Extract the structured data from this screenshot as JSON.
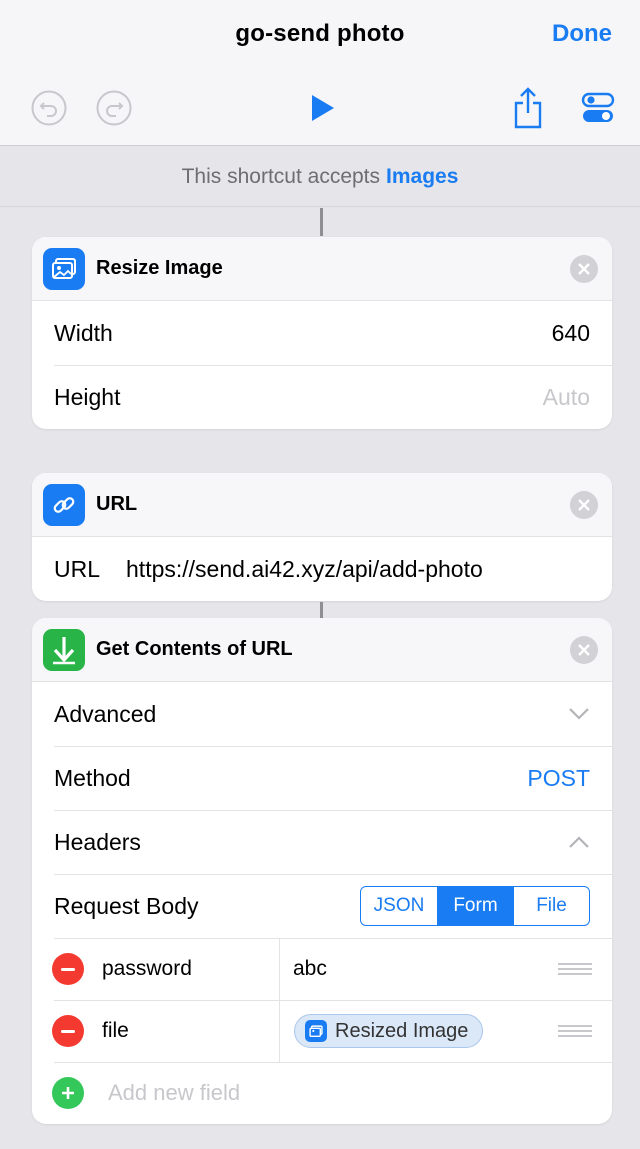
{
  "header": {
    "title": "go-send photo",
    "done_label": "Done"
  },
  "toolbar": {
    "icons": [
      "undo-icon",
      "redo-icon",
      "play-icon",
      "share-icon",
      "settings-toggle-icon"
    ]
  },
  "accepts": {
    "prefix": "This shortcut accepts",
    "type": "Images"
  },
  "actions": {
    "resize": {
      "title": "Resize Image",
      "width_label": "Width",
      "width_value": "640",
      "height_label": "Height",
      "height_placeholder": "Auto"
    },
    "url": {
      "title": "URL",
      "url_label": "URL",
      "url_value": "https://send.ai42.xyz/api/add-photo"
    },
    "get_contents": {
      "title": "Get Contents of URL",
      "advanced_label": "Advanced",
      "method_label": "Method",
      "method_value": "POST",
      "headers_label": "Headers",
      "request_body_label": "Request Body",
      "body_options": [
        "JSON",
        "Form",
        "File"
      ],
      "body_selected": "Form",
      "fields": [
        {
          "key": "password",
          "value": "abc"
        },
        {
          "key": "file",
          "value": "Resized Image"
        }
      ],
      "add_field_placeholder": "Add new field"
    }
  },
  "colors": {
    "accent": "#1a7cf2",
    "green": "#34c759",
    "red": "#f43a30",
    "download_green": "#28b446"
  }
}
